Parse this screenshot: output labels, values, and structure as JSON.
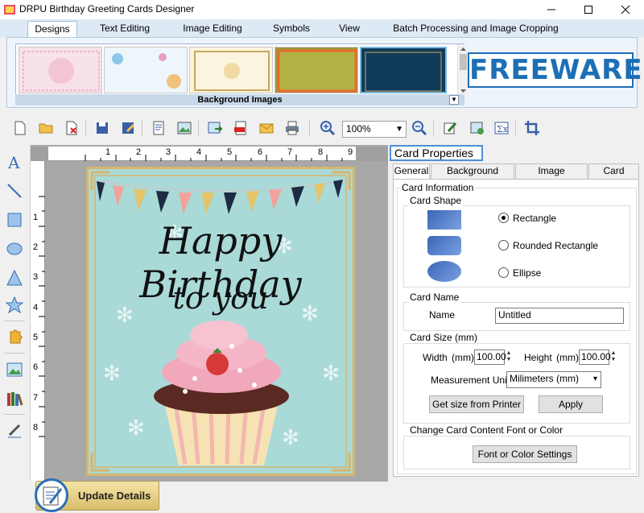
{
  "window": {
    "title": "DRPU Birthday Greeting Cards Designer"
  },
  "ribbon_tabs": [
    "Designs",
    "Text Editing",
    "Image Editing",
    "Symbols",
    "View",
    "Batch Processing and Image Cropping"
  ],
  "ribbon": {
    "gallery_label": "Background Images",
    "badge": "FREEWARE"
  },
  "toolbar": {
    "zoom": "100%"
  },
  "rulers": {
    "horizontal": [
      "1",
      "2",
      "3",
      "4",
      "5",
      "6",
      "7",
      "8",
      "9"
    ],
    "vertical": [
      "1",
      "2",
      "3",
      "4",
      "5",
      "6",
      "7",
      "8"
    ]
  },
  "card": {
    "line1": "Happy Birthday",
    "line2": "to you"
  },
  "properties": {
    "title": "Card Properties",
    "tabs": [
      "General",
      "Background Format",
      "Image Properties",
      "Card Border"
    ],
    "card_information": "Card Information",
    "card_shape": "Card Shape",
    "shapes": [
      "Rectangle",
      "Rounded Rectangle",
      "Ellipse"
    ],
    "selected_shape": "Rectangle",
    "card_name_group": "Card Name",
    "name_label": "Name",
    "name_value": "Untitled",
    "card_size_group": "Card Size (mm)",
    "width_label": "Width",
    "height_label": "Height",
    "unit_abbr": "(mm)",
    "width_value": "100.00",
    "height_value": "100.00",
    "measurement_label": "Measurement Unit :",
    "measurement_value": "Milimeters (mm)",
    "get_size_button": "Get size from Printer",
    "apply_button": "Apply",
    "font_group": "Change Card Content Font or Color",
    "font_button": "Font or Color Settings"
  },
  "footer": {
    "update_button": "Update Details"
  },
  "colors": {
    "accent": "#1c6fb5",
    "card_bg": "#a9dad8",
    "card_frame": "#d6b66d",
    "ribbon_bg": "#dde9f5"
  }
}
